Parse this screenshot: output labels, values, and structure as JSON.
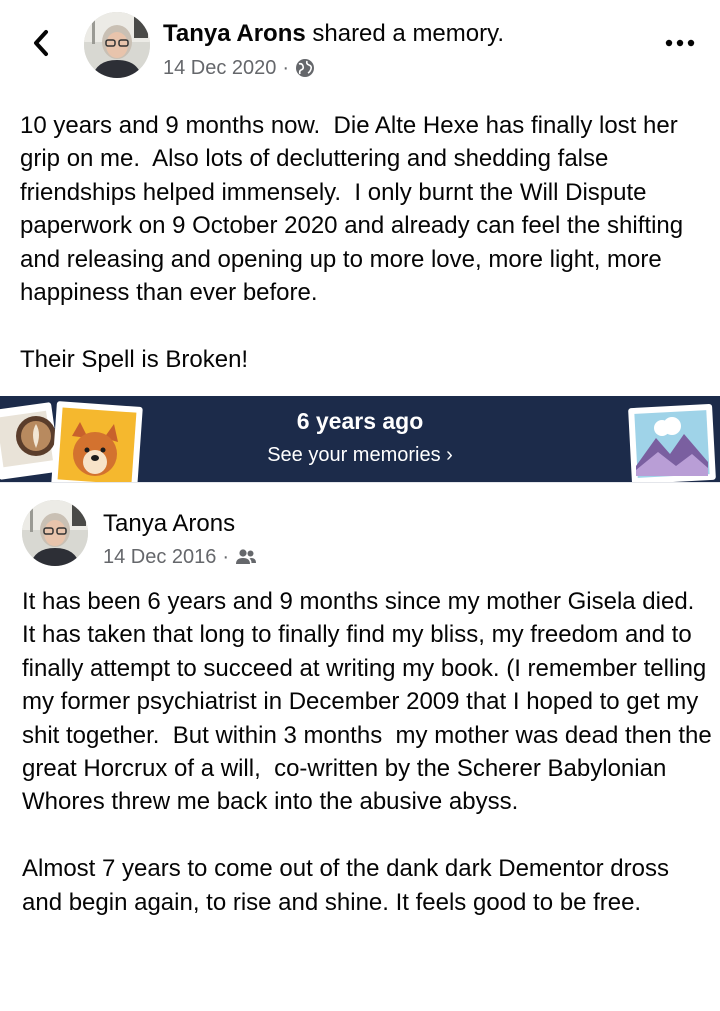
{
  "memory_header": {
    "author": "Tanya Arons",
    "action": " shared a memory.",
    "date": "14 Dec 2020",
    "separator": "·",
    "audience_icon": "globe-icon",
    "more_icon": "more-options-icon",
    "back_icon": "chevron-left-icon"
  },
  "memory_post": {
    "text": "10 years and 9 months now.  Die Alte Hexe has finally lost her grip on me.  Also lots of decluttering and shedding false friendships helped immensely.  I only burnt the Will Dispute paperwork on 9 October 2020 and already can feel the shifting and releasing and opening up to more love, more light, more happiness than ever before.\n\nTheir Spell is Broken!"
  },
  "memories_banner": {
    "title": "6 years ago",
    "link": "See your memories ›",
    "background": "#1c2b4a"
  },
  "original_post": {
    "author": "Tanya Arons",
    "date": "14 Dec 2016",
    "separator": "·",
    "audience_icon": "friends-icon",
    "text": "It has been 6 years and 9 months since my mother Gisela died.  It has taken that long to finally find my bliss, my freedom and to finally attempt to succeed at writing my book. (I remember telling my former psychiatrist in December 2009 that I hoped to get my shit together.  But within 3 months  my mother was dead then the great Horcrux of a will,  co-written by the Scherer Babylonian Whores threw me back into the abusive abyss.\n\nAlmost 7 years to come out of the dank dark Dementor dross and begin again, to rise and shine. It feels good to be free."
  }
}
